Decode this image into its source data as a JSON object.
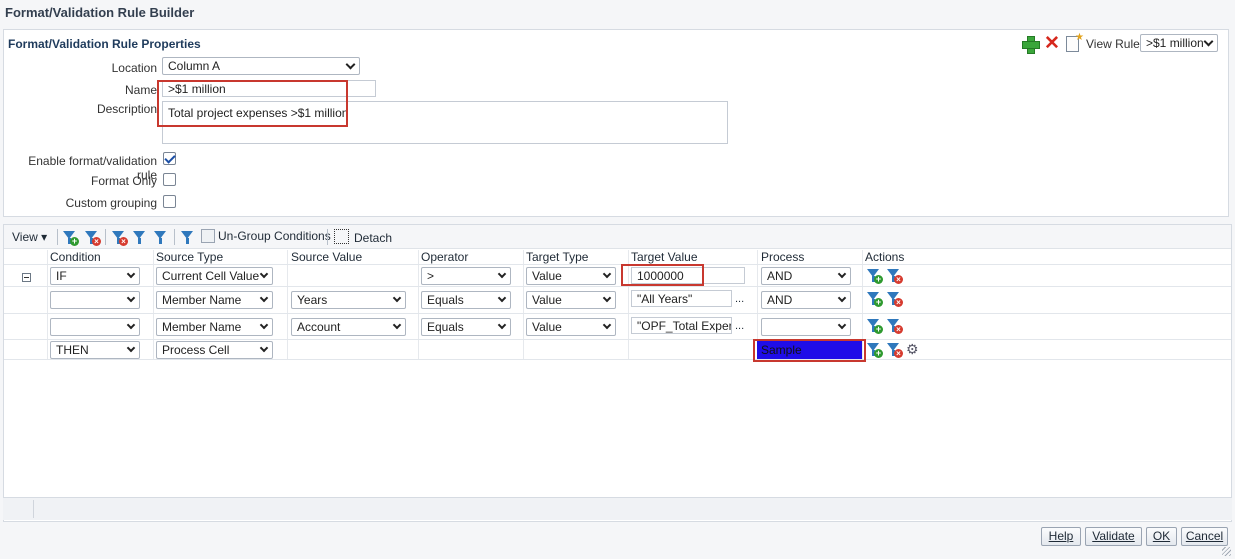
{
  "page": {
    "title": "Format/Validation Rule Builder"
  },
  "props": {
    "title": "Format/Validation Rule Properties",
    "location_label": "Location",
    "location_value": "Column A",
    "name_label": "Name",
    "name_value": ">$1 million",
    "description_label": "Description",
    "description_value": "Total project expenses >$1 million",
    "enable_label": "Enable format/validation rule",
    "enable_checked": true,
    "format_only_label": "Format Only",
    "format_only_checked": false,
    "custom_grouping_label": "Custom grouping",
    "custom_grouping_checked": false,
    "view_rule_label": "View Rule",
    "view_rule_value": ">$1 million"
  },
  "toolbar": {
    "view_label": "View",
    "ungroup_label": "Un-Group Conditions",
    "detach_label": "Detach"
  },
  "grid": {
    "columns": [
      "Condition",
      "Source Type",
      "Source Value",
      "Operator",
      "Target Type",
      "Target Value",
      "Process",
      "Actions"
    ],
    "rows": [
      {
        "condition": "IF",
        "source_type": "Current Cell Value",
        "source_value": "",
        "operator": ">",
        "target_type": "Value",
        "target_value": "1000000",
        "process": "AND"
      },
      {
        "condition": "",
        "source_type": "Member Name",
        "source_value": "Years",
        "operator": "Equals",
        "target_type": "Value",
        "target_value": "\"All Years\"",
        "target_suffix": "...",
        "process": "AND"
      },
      {
        "condition": "",
        "source_type": "Member Name",
        "source_value": "Account",
        "operator": "Equals",
        "target_type": "Value",
        "target_value": "\"OPF_Total Expense",
        "target_suffix": "...",
        "process": ""
      },
      {
        "condition": "THEN",
        "source_type": "Process Cell",
        "process_sample": "Sample"
      }
    ]
  },
  "footer": {
    "help_label": "Help",
    "validate_label": "Validate",
    "ok_label": "OK",
    "cancel_label": "Cancel"
  },
  "colors": {
    "highlight": "#c8382f",
    "sample_fill": "#1f0de8",
    "accent": "#2f78bc"
  }
}
